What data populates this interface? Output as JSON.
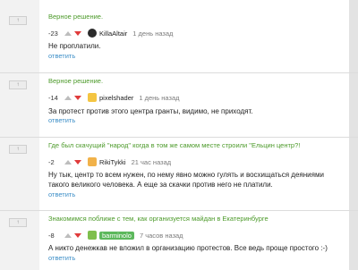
{
  "reply_button_label": "↑",
  "comments": [
    {
      "parent": "Верное решение.",
      "score": "-23",
      "author": "KillaAltair",
      "time": "1 день назад",
      "body": "Не проплатили.",
      "reply": "ответить"
    },
    {
      "parent": "Верное решение.",
      "score": "-14",
      "author": "pixelshader",
      "time": "1 день назад",
      "body": "За протест против этого центра гранты, видимо, не приходят.",
      "reply": "ответить"
    },
    {
      "parent": "Где был скачущий \"народ\" когда в том же самом месте строили \"Ельцин центр?!",
      "score": "-2",
      "author": "RikiTykki",
      "time": "21 час назад",
      "body": "Ну тык, центр то всем нужен, по нему явно можно гулять и восхищаться деяниями такого великого человека. А еще за скачки против него не платили.",
      "reply": "ответить"
    },
    {
      "parent": "Знакомимся поближе с тем, как организуется майдан в Екатеринбурге",
      "score": "-8",
      "author": "barminolo",
      "time": "7 часов назад",
      "body": "А никто денежкав не вложил в организацию протестов. Все ведь проще простого :-)",
      "reply": "ответить"
    }
  ]
}
